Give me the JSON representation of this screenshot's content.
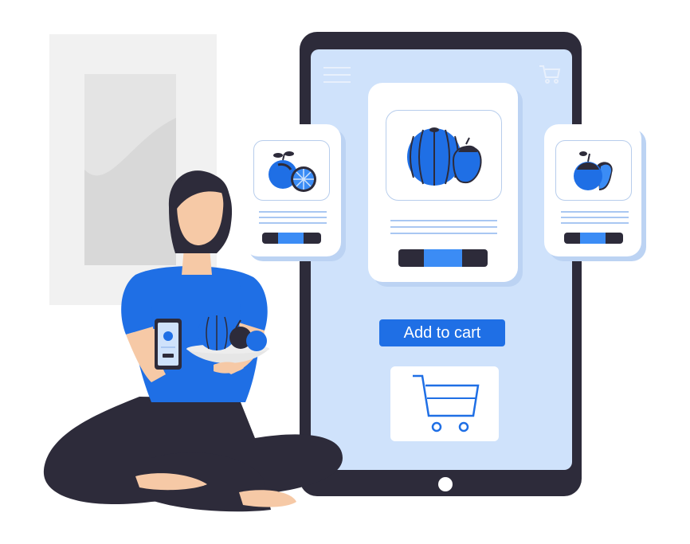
{
  "tablet": {
    "add_to_cart_label": "Add to cart"
  },
  "icons": {
    "menu": "hamburger-menu-icon",
    "cart_top": "shopping-cart-icon",
    "cart_large": "shopping-cart-icon"
  },
  "colors": {
    "accent_blue": "#1f6fe5",
    "dark": "#2d2b3a",
    "screen_bg": "#cfe2fb",
    "skin": "#f6c9a6"
  }
}
